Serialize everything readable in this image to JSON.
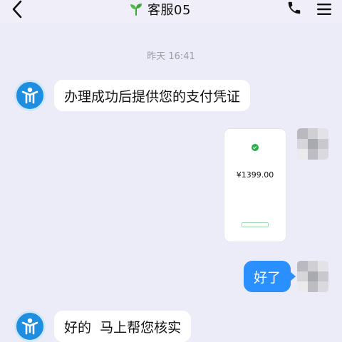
{
  "header": {
    "title": "客服05",
    "icons": [
      "back-icon",
      "sprout-icon",
      "phone-icon",
      "menu-icon"
    ]
  },
  "timestamp": "昨天 16:41",
  "messages": [
    {
      "side": "left",
      "text": "办理成功后提供您的支付凭证"
    },
    {
      "side": "right",
      "type": "image",
      "receipt": {
        "amount": "¥1399.00"
      }
    },
    {
      "side": "right",
      "text": "好了"
    },
    {
      "side": "left",
      "text": "好的  马上帮您核实"
    }
  ],
  "colors": {
    "background": "#ecebf8",
    "bubble_right": "#2a8fff",
    "bubble_left": "#ffffff",
    "avatar": "#1e8fe0",
    "success_green": "#24b14a"
  }
}
